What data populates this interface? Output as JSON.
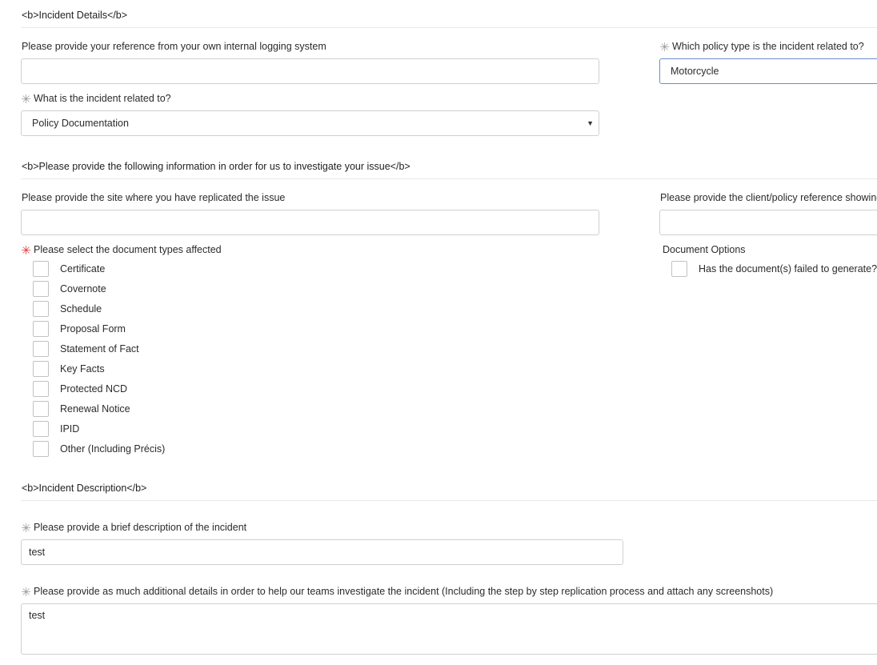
{
  "sections": {
    "details_title": "<b>Incident Details</b>",
    "investigate_title": "<b>Please provide the following information in order for us to investigate your issue</b>",
    "description_title": "<b>Incident Description</b>"
  },
  "reference": {
    "label": "Please provide your reference from your own internal logging system",
    "value": ""
  },
  "policy_type": {
    "label": "Which policy type is the incident related to?",
    "value": "Motorcycle"
  },
  "related_to": {
    "label": "What is the incident related to?",
    "value": "Policy Documentation",
    "arrow": "▼"
  },
  "site": {
    "label": "Please provide the site where you have replicated the issue",
    "value": ""
  },
  "client_ref": {
    "label": "Please provide the client/policy reference showing",
    "value": ""
  },
  "doc_types": {
    "label": "Please select the document types affected",
    "options": [
      "Certificate",
      "Covernote",
      "Schedule",
      "Proposal Form",
      "Statement of Fact",
      "Key Facts",
      "Protected NCD",
      "Renewal Notice",
      "IPID",
      "Other (Including Précis)"
    ]
  },
  "doc_options": {
    "label": "Document Options",
    "failed_label": "Has the document(s) failed to generate?"
  },
  "brief": {
    "label": "Please provide a brief description of the incident",
    "value": "test"
  },
  "details": {
    "label": "Please provide as much additional details in order to help our teams investigate the incident (Including the step by step replication process and attach any screenshots)",
    "value": "test"
  },
  "required_mark": "✳",
  "colors": {
    "required_grey": "#9a9a9a",
    "required_red": "#e03a3a",
    "focus_border": "#6a8fc7"
  }
}
